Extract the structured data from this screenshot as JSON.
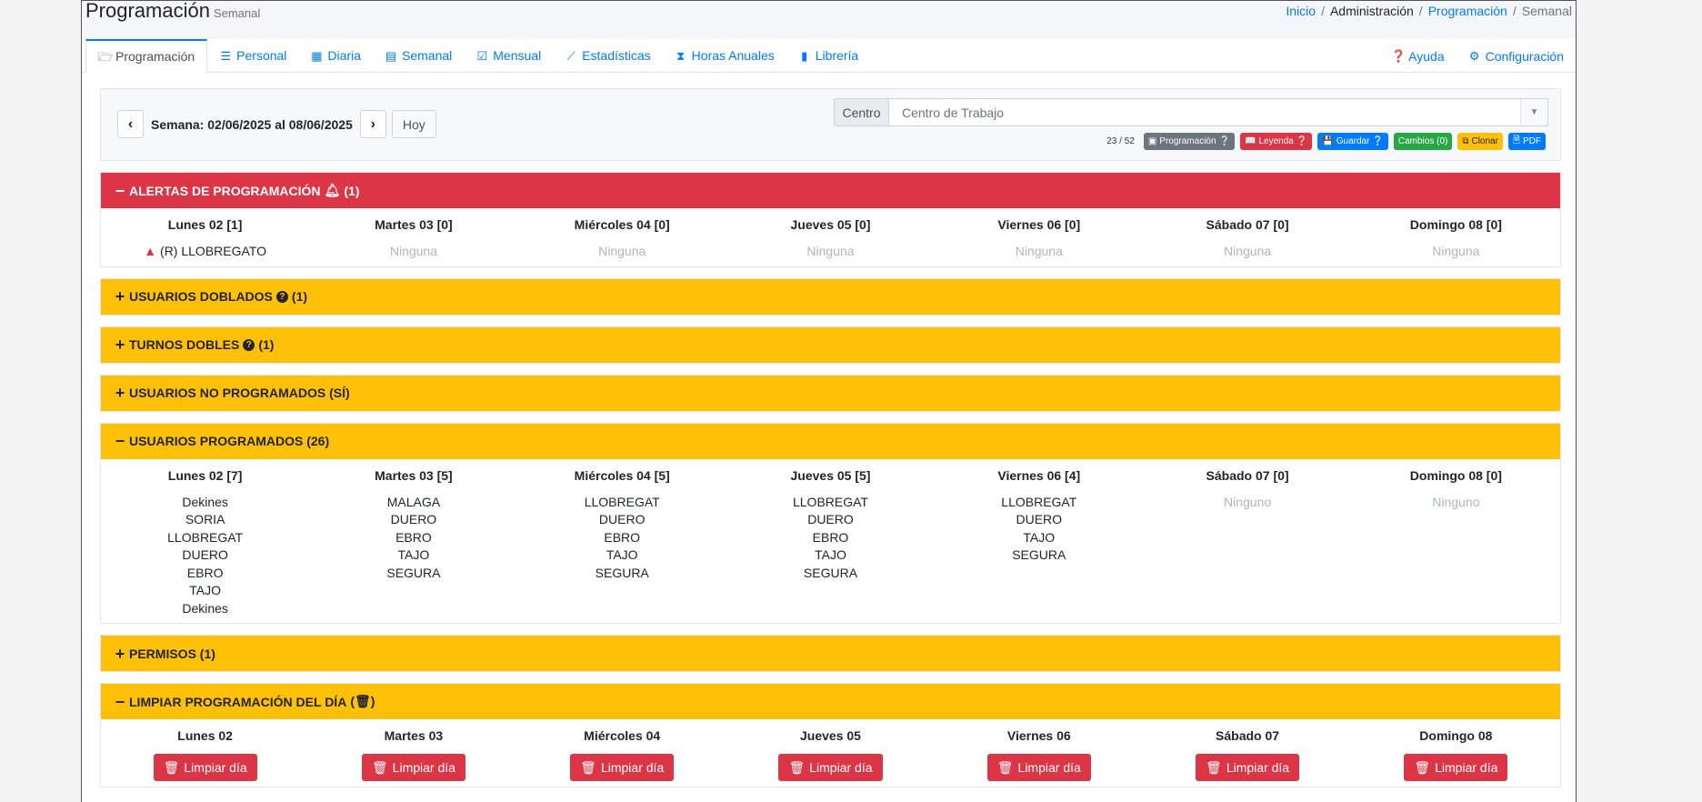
{
  "header": {
    "title": "Programación",
    "subtitle": "Semanal",
    "breadcrumb": [
      "Inicio",
      "Administración",
      "Programación",
      "Semanal"
    ]
  },
  "tabs": [
    {
      "label": "Programación",
      "icon": "folder-open-icon"
    },
    {
      "label": "Personal",
      "icon": "list-icon"
    },
    {
      "label": "Diaria",
      "icon": "calendar-day-icon"
    },
    {
      "label": "Semanal",
      "icon": "calendar-week-icon"
    },
    {
      "label": "Mensual",
      "icon": "calendar-check-icon"
    },
    {
      "label": "Estadísticas",
      "icon": "chart-line-icon"
    },
    {
      "label": "Horas Anuales",
      "icon": "hourglass-icon"
    },
    {
      "label": "Librería",
      "icon": "book-icon"
    }
  ],
  "tabs_right": [
    {
      "label": "Ayuda",
      "icon": "question-circle-icon"
    },
    {
      "label": "Configuración",
      "icon": "gear-icon"
    }
  ],
  "toolbar": {
    "week_label": "Semana: 02/06/2025 al 08/06/2025",
    "today": "Hoy",
    "centro_label": "Centro",
    "centro_placeholder": "Centro de Trabajo",
    "counter": "23 / 52",
    "buttons": {
      "programacion": "Programación",
      "leyenda": "Leyenda",
      "guardar": "Guardar",
      "cambios": "Cambios (0)",
      "clonar": "Clonar",
      "pdf": "PDF"
    }
  },
  "colors": {
    "danger": "#dc3545",
    "warning": "#ffc107",
    "primary": "#007bff",
    "success": "#28a745",
    "secondary": "#6c757d"
  },
  "alertas": {
    "title": "ALERTAS DE PROGRAMACIÓN",
    "count": "(1)",
    "days": [
      {
        "h": "Lunes 02 [1]",
        "items": [
          "(R) LLOBREGATO"
        ],
        "warn": true
      },
      {
        "h": "Martes 03 [0]",
        "items": [
          "Ninguna"
        ]
      },
      {
        "h": "Miércoles 04 [0]",
        "items": [
          "Ninguna"
        ]
      },
      {
        "h": "Jueves 05 [0]",
        "items": [
          "Ninguna"
        ]
      },
      {
        "h": "Viernes 06 [0]",
        "items": [
          "Ninguna"
        ]
      },
      {
        "h": "Sábado 07 [0]",
        "items": [
          "Ninguna"
        ]
      },
      {
        "h": "Domingo 08 [0]",
        "items": [
          "Ninguna"
        ]
      }
    ]
  },
  "usuarios_doblados": {
    "title": "USUARIOS DOBLADOS",
    "count": "(1)"
  },
  "turnos_dobles": {
    "title": "TURNOS DOBLES",
    "count": "(1)"
  },
  "no_programados": {
    "title": "USUARIOS NO PROGRAMADOS (SÍ)"
  },
  "programados": {
    "title": "USUARIOS PROGRAMADOS (26)",
    "days": [
      {
        "h": "Lunes 02 [7]",
        "items": [
          "Dekines",
          "SORIA",
          "LLOBREGAT",
          "DUERO",
          "EBRO",
          "TAJO",
          "Dekines"
        ]
      },
      {
        "h": "Martes 03 [5]",
        "items": [
          "MALAGA",
          "DUERO",
          "EBRO",
          "TAJO",
          "SEGURA"
        ]
      },
      {
        "h": "Miércoles 04 [5]",
        "items": [
          "LLOBREGAT",
          "DUERO",
          "EBRO",
          "TAJO",
          "SEGURA"
        ]
      },
      {
        "h": "Jueves 05 [5]",
        "items": [
          "LLOBREGAT",
          "DUERO",
          "EBRO",
          "TAJO",
          "SEGURA"
        ]
      },
      {
        "h": "Viernes 06 [4]",
        "items": [
          "LLOBREGAT",
          "DUERO",
          "TAJO",
          "SEGURA"
        ]
      },
      {
        "h": "Sábado 07 [0]",
        "items": [
          "Ninguno"
        ],
        "empty": true
      },
      {
        "h": "Domingo 08 [0]",
        "items": [
          "Ninguno"
        ],
        "empty": true
      }
    ]
  },
  "permisos": {
    "title": "PERMISOS (1)"
  },
  "limpiar": {
    "title": "LIMPIAR PROGRAMACIÓN DEL DÍA",
    "button": "Limpiar día",
    "days": [
      "Lunes 02",
      "Martes 03",
      "Miércoles 04",
      "Jueves 05",
      "Viernes 06",
      "Sábado 07",
      "Domingo 08"
    ]
  }
}
